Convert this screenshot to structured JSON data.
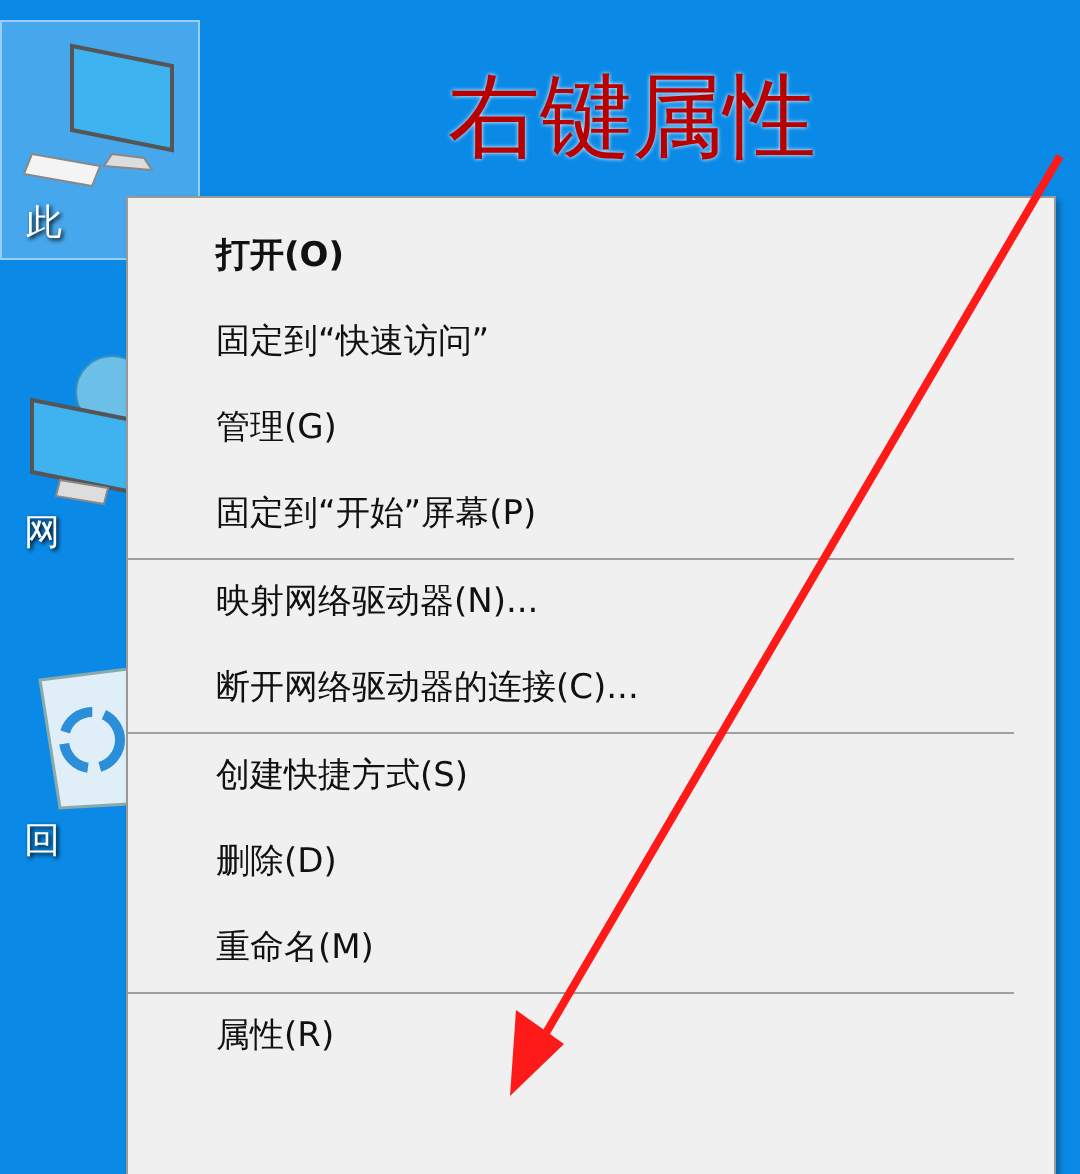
{
  "desktop_icons": [
    {
      "kind": "computer",
      "label": "此",
      "selected": true
    },
    {
      "kind": "network",
      "label": "网",
      "selected": false
    },
    {
      "kind": "recycle",
      "label": "回",
      "selected": false
    }
  ],
  "annotation": {
    "text": "右键属性"
  },
  "context_menu": {
    "groups": [
      [
        {
          "label": "打开(O)",
          "default": true
        },
        {
          "label": "固定到“快速访问”",
          "default": false
        },
        {
          "label": "管理(G)",
          "default": false
        },
        {
          "label": "固定到“开始”屏幕(P)",
          "default": false
        }
      ],
      [
        {
          "label": "映射网络驱动器(N)...",
          "default": false
        },
        {
          "label": "断开网络驱动器的连接(C)...",
          "default": false
        }
      ],
      [
        {
          "label": "创建快捷方式(S)",
          "default": false
        },
        {
          "label": "删除(D)",
          "default": false
        },
        {
          "label": "重命名(M)",
          "default": false
        }
      ],
      [
        {
          "label": "属性(R)",
          "default": false
        }
      ]
    ]
  }
}
